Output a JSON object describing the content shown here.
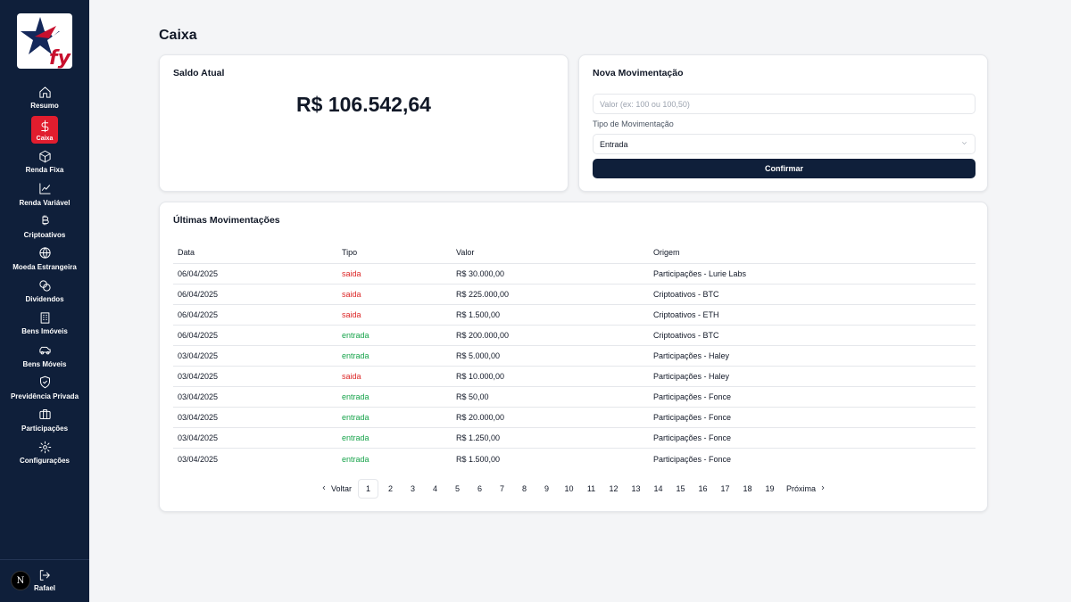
{
  "page": {
    "title": "Caixa"
  },
  "sidebar": {
    "logo_text": "fy",
    "items": [
      {
        "label": "Resumo",
        "icon": "home-icon",
        "active": false
      },
      {
        "label": "Caixa",
        "icon": "dollar-icon",
        "active": true
      },
      {
        "label": "Renda Fixa",
        "icon": "box-icon",
        "active": false
      },
      {
        "label": "Renda Variável",
        "icon": "chart-line-icon",
        "active": false
      },
      {
        "label": "Criptoativos",
        "icon": "bitcoin-icon",
        "active": false
      },
      {
        "label": "Moeda Estrangeira",
        "icon": "globe-icon",
        "active": false
      },
      {
        "label": "Dividendos",
        "icon": "coins-icon",
        "active": false
      },
      {
        "label": "Bens Imóveis",
        "icon": "building-icon",
        "active": false
      },
      {
        "label": "Bens Móveis",
        "icon": "car-icon",
        "active": false
      },
      {
        "label": "Previdência Privada",
        "icon": "shield-icon",
        "active": false
      },
      {
        "label": "Participações",
        "icon": "briefcase-icon",
        "active": false
      },
      {
        "label": "Configurações",
        "icon": "gear-icon",
        "active": false
      }
    ],
    "user": {
      "initial": "N",
      "name": "Rafael"
    }
  },
  "balance": {
    "title": "Saldo Atual",
    "value": "R$ 106.542,64"
  },
  "new_movement": {
    "title": "Nova Movimentação",
    "value_placeholder": "Valor (ex: 100 ou 100,50)",
    "type_label": "Tipo de Movimentação",
    "type_value": "Entrada",
    "confirm_label": "Confirmar"
  },
  "movements": {
    "title": "Últimas Movimentações",
    "columns": [
      "Data",
      "Tipo",
      "Valor",
      "Origem"
    ],
    "rows": [
      {
        "data": "06/04/2025",
        "tipo": "saida",
        "valor": "R$ 30.000,00",
        "origem": "Participações - Lurie Labs"
      },
      {
        "data": "06/04/2025",
        "tipo": "saida",
        "valor": "R$ 225.000,00",
        "origem": "Criptoativos - BTC"
      },
      {
        "data": "06/04/2025",
        "tipo": "saida",
        "valor": "R$ 1.500,00",
        "origem": "Criptoativos - ETH"
      },
      {
        "data": "06/04/2025",
        "tipo": "entrada",
        "valor": "R$ 200.000,00",
        "origem": "Criptoativos - BTC"
      },
      {
        "data": "03/04/2025",
        "tipo": "entrada",
        "valor": "R$ 5.000,00",
        "origem": "Participações - Haley"
      },
      {
        "data": "03/04/2025",
        "tipo": "saida",
        "valor": "R$ 10.000,00",
        "origem": "Participações - Haley"
      },
      {
        "data": "03/04/2025",
        "tipo": "entrada",
        "valor": "R$ 50,00",
        "origem": "Participações - Fonce"
      },
      {
        "data": "03/04/2025",
        "tipo": "entrada",
        "valor": "R$ 20.000,00",
        "origem": "Participações - Fonce"
      },
      {
        "data": "03/04/2025",
        "tipo": "entrada",
        "valor": "R$ 1.250,00",
        "origem": "Participações - Fonce"
      },
      {
        "data": "03/04/2025",
        "tipo": "entrada",
        "valor": "R$ 1.500,00",
        "origem": "Participações - Fonce"
      }
    ]
  },
  "pagination": {
    "prev_label": "Voltar",
    "next_label": "Próxima",
    "current": "1",
    "pages": [
      "1",
      "2",
      "3",
      "4",
      "5",
      "6",
      "7",
      "8",
      "9",
      "10",
      "11",
      "12",
      "13",
      "14",
      "15",
      "16",
      "17",
      "18",
      "19"
    ]
  },
  "colors": {
    "sidebar": "#0f1f3a",
    "accent": "#e11d2e",
    "saida": "#dc2626",
    "entrada": "#16a34a"
  }
}
